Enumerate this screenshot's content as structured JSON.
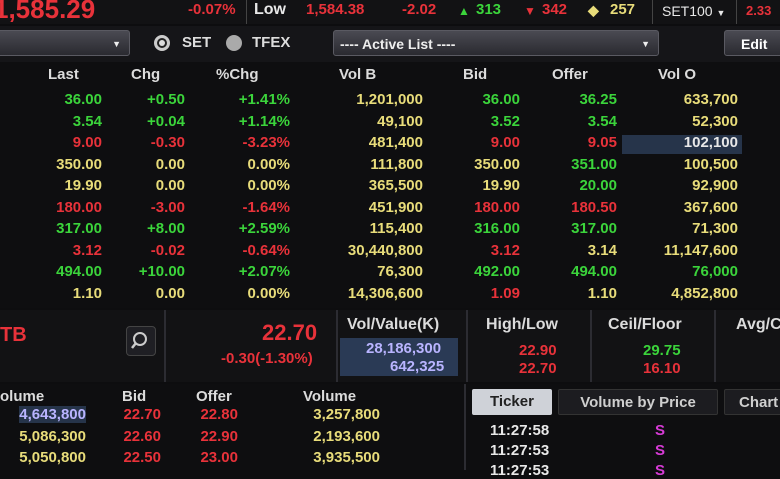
{
  "top": {
    "price": "1,585.29",
    "chg_pct": "-0.07%",
    "low_label": "Low",
    "low_value": "1,584.38",
    "change": "-2.02",
    "up_count": "313",
    "down_count": "342",
    "unch_count": "257",
    "index_select": "SET100",
    "right_value": "2.33"
  },
  "toolbar": {
    "radio_set": "SET",
    "radio_tfex": "TFEX",
    "active_list": "---- Active List ----",
    "edit": "Edit"
  },
  "grid": {
    "headers": [
      "Last",
      "Chg",
      "%Chg",
      "Vol B",
      "Bid",
      "Offer",
      "Vol O"
    ],
    "rows": [
      {
        "last": "36.00",
        "chg": "+0.50",
        "pct": "+1.41%",
        "volb": "1,201,000",
        "bid": "36.00",
        "offer": "36.25",
        "volo": "633,700",
        "c": [
          "g",
          "g",
          "g",
          "y",
          "g",
          "g",
          "y"
        ]
      },
      {
        "last": "3.54",
        "chg": "+0.04",
        "pct": "+1.14%",
        "volb": "49,100",
        "bid": "3.52",
        "offer": "3.54",
        "volo": "52,300",
        "c": [
          "g",
          "g",
          "g",
          "y",
          "g",
          "g",
          "y"
        ]
      },
      {
        "last": "9.00",
        "chg": "-0.30",
        "pct": "-3.23%",
        "volb": "481,400",
        "bid": "9.00",
        "offer": "9.05",
        "volo": "102,100",
        "c": [
          "r",
          "r",
          "r",
          "y",
          "r",
          "r",
          "w"
        ]
      },
      {
        "last": "350.00",
        "chg": "0.00",
        "pct": "0.00%",
        "volb": "111,800",
        "bid": "350.00",
        "offer": "351.00",
        "volo": "100,500",
        "c": [
          "y",
          "y",
          "y",
          "y",
          "y",
          "g",
          "y"
        ]
      },
      {
        "last": "19.90",
        "chg": "0.00",
        "pct": "0.00%",
        "volb": "365,500",
        "bid": "19.90",
        "offer": "20.00",
        "volo": "92,900",
        "c": [
          "y",
          "y",
          "y",
          "y",
          "y",
          "g",
          "y"
        ]
      },
      {
        "last": "180.00",
        "chg": "-3.00",
        "pct": "-1.64%",
        "volb": "451,900",
        "bid": "180.00",
        "offer": "180.50",
        "volo": "367,600",
        "c": [
          "r",
          "r",
          "r",
          "y",
          "r",
          "r",
          "y"
        ]
      },
      {
        "last": "317.00",
        "chg": "+8.00",
        "pct": "+2.59%",
        "volb": "115,400",
        "bid": "316.00",
        "offer": "317.00",
        "volo": "71,300",
        "c": [
          "g",
          "g",
          "g",
          "y",
          "g",
          "g",
          "y"
        ]
      },
      {
        "last": "3.12",
        "chg": "-0.02",
        "pct": "-0.64%",
        "volb": "30,440,800",
        "bid": "3.12",
        "offer": "3.14",
        "volo": "11,147,600",
        "c": [
          "r",
          "r",
          "r",
          "y",
          "r",
          "y",
          "y"
        ]
      },
      {
        "last": "494.00",
        "chg": "+10.00",
        "pct": "+2.07%",
        "volb": "76,300",
        "bid": "492.00",
        "offer": "494.00",
        "volo": "76,000",
        "c": [
          "g",
          "g",
          "g",
          "y",
          "g",
          "g",
          "g"
        ]
      },
      {
        "last": "1.10",
        "chg": "0.00",
        "pct": "0.00%",
        "volb": "14,306,600",
        "bid": "1.09",
        "offer": "1.10",
        "volo": "4,852,800",
        "c": [
          "y",
          "y",
          "y",
          "y",
          "r",
          "y",
          "y"
        ]
      }
    ]
  },
  "info": {
    "symbol_partial": "TB",
    "price": "22.70",
    "change": "-0.30(-1.30%)",
    "vol_value_label": "Vol/Value(K)",
    "volume": "28,186,300",
    "value": "642,325",
    "high_low_label": "High/Low",
    "high": "22.90",
    "low": "22.70",
    "ceil_floor_label": "Ceil/Floor",
    "ceil": "29.75",
    "floor": "16.10",
    "avg_label": "Avg/C"
  },
  "depth": {
    "headers": [
      "olume",
      "Bid",
      "Offer",
      "Volume"
    ],
    "rows": [
      {
        "bvol": "4,643,800",
        "bid": "22.70",
        "offer": "22.80",
        "ovol": "3,257,800"
      },
      {
        "bvol": "5,086,300",
        "bid": "22.60",
        "offer": "22.90",
        "ovol": "2,193,600"
      },
      {
        "bvol": "5,050,800",
        "bid": "22.50",
        "offer": "23.00",
        "ovol": "3,935,500"
      }
    ]
  },
  "ticker": {
    "tabs": [
      "Ticker",
      "Volume by Price",
      "Chart"
    ],
    "rows": [
      {
        "time": "11:27:58",
        "side": "S"
      },
      {
        "time": "11:27:53",
        "side": "S"
      },
      {
        "time": "11:27:53",
        "side": "S"
      }
    ]
  }
}
